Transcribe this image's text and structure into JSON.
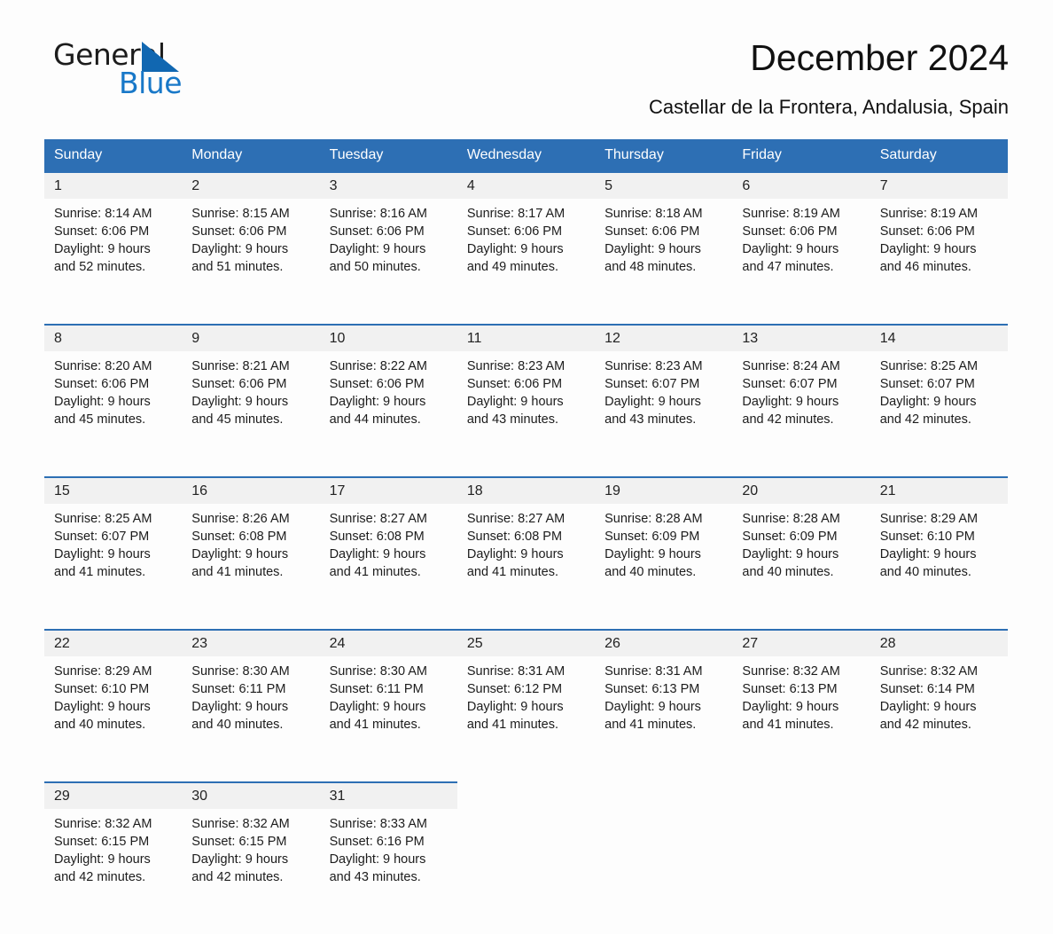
{
  "brand": {
    "name_part1": "General",
    "name_part2": "Blue",
    "accent_color": "#1167b1"
  },
  "header": {
    "title": "December 2024",
    "subtitle": "Castellar de la Frontera, Andalusia, Spain",
    "header_bg_color": "#2d6fb4",
    "date_band_color": "#f1f1f1"
  },
  "weekdays": [
    "Sunday",
    "Monday",
    "Tuesday",
    "Wednesday",
    "Thursday",
    "Friday",
    "Saturday"
  ],
  "weeks": [
    {
      "days": [
        {
          "date": "1",
          "sunrise": "Sunrise: 8:14 AM",
          "sunset": "Sunset: 6:06 PM",
          "daylight1": "Daylight: 9 hours",
          "daylight2": "and 52 minutes."
        },
        {
          "date": "2",
          "sunrise": "Sunrise: 8:15 AM",
          "sunset": "Sunset: 6:06 PM",
          "daylight1": "Daylight: 9 hours",
          "daylight2": "and 51 minutes."
        },
        {
          "date": "3",
          "sunrise": "Sunrise: 8:16 AM",
          "sunset": "Sunset: 6:06 PM",
          "daylight1": "Daylight: 9 hours",
          "daylight2": "and 50 minutes."
        },
        {
          "date": "4",
          "sunrise": "Sunrise: 8:17 AM",
          "sunset": "Sunset: 6:06 PM",
          "daylight1": "Daylight: 9 hours",
          "daylight2": "and 49 minutes."
        },
        {
          "date": "5",
          "sunrise": "Sunrise: 8:18 AM",
          "sunset": "Sunset: 6:06 PM",
          "daylight1": "Daylight: 9 hours",
          "daylight2": "and 48 minutes."
        },
        {
          "date": "6",
          "sunrise": "Sunrise: 8:19 AM",
          "sunset": "Sunset: 6:06 PM",
          "daylight1": "Daylight: 9 hours",
          "daylight2": "and 47 minutes."
        },
        {
          "date": "7",
          "sunrise": "Sunrise: 8:19 AM",
          "sunset": "Sunset: 6:06 PM",
          "daylight1": "Daylight: 9 hours",
          "daylight2": "and 46 minutes."
        }
      ]
    },
    {
      "days": [
        {
          "date": "8",
          "sunrise": "Sunrise: 8:20 AM",
          "sunset": "Sunset: 6:06 PM",
          "daylight1": "Daylight: 9 hours",
          "daylight2": "and 45 minutes."
        },
        {
          "date": "9",
          "sunrise": "Sunrise: 8:21 AM",
          "sunset": "Sunset: 6:06 PM",
          "daylight1": "Daylight: 9 hours",
          "daylight2": "and 45 minutes."
        },
        {
          "date": "10",
          "sunrise": "Sunrise: 8:22 AM",
          "sunset": "Sunset: 6:06 PM",
          "daylight1": "Daylight: 9 hours",
          "daylight2": "and 44 minutes."
        },
        {
          "date": "11",
          "sunrise": "Sunrise: 8:23 AM",
          "sunset": "Sunset: 6:06 PM",
          "daylight1": "Daylight: 9 hours",
          "daylight2": "and 43 minutes."
        },
        {
          "date": "12",
          "sunrise": "Sunrise: 8:23 AM",
          "sunset": "Sunset: 6:07 PM",
          "daylight1": "Daylight: 9 hours",
          "daylight2": "and 43 minutes."
        },
        {
          "date": "13",
          "sunrise": "Sunrise: 8:24 AM",
          "sunset": "Sunset: 6:07 PM",
          "daylight1": "Daylight: 9 hours",
          "daylight2": "and 42 minutes."
        },
        {
          "date": "14",
          "sunrise": "Sunrise: 8:25 AM",
          "sunset": "Sunset: 6:07 PM",
          "daylight1": "Daylight: 9 hours",
          "daylight2": "and 42 minutes."
        }
      ]
    },
    {
      "days": [
        {
          "date": "15",
          "sunrise": "Sunrise: 8:25 AM",
          "sunset": "Sunset: 6:07 PM",
          "daylight1": "Daylight: 9 hours",
          "daylight2": "and 41 minutes."
        },
        {
          "date": "16",
          "sunrise": "Sunrise: 8:26 AM",
          "sunset": "Sunset: 6:08 PM",
          "daylight1": "Daylight: 9 hours",
          "daylight2": "and 41 minutes."
        },
        {
          "date": "17",
          "sunrise": "Sunrise: 8:27 AM",
          "sunset": "Sunset: 6:08 PM",
          "daylight1": "Daylight: 9 hours",
          "daylight2": "and 41 minutes."
        },
        {
          "date": "18",
          "sunrise": "Sunrise: 8:27 AM",
          "sunset": "Sunset: 6:08 PM",
          "daylight1": "Daylight: 9 hours",
          "daylight2": "and 41 minutes."
        },
        {
          "date": "19",
          "sunrise": "Sunrise: 8:28 AM",
          "sunset": "Sunset: 6:09 PM",
          "daylight1": "Daylight: 9 hours",
          "daylight2": "and 40 minutes."
        },
        {
          "date": "20",
          "sunrise": "Sunrise: 8:28 AM",
          "sunset": "Sunset: 6:09 PM",
          "daylight1": "Daylight: 9 hours",
          "daylight2": "and 40 minutes."
        },
        {
          "date": "21",
          "sunrise": "Sunrise: 8:29 AM",
          "sunset": "Sunset: 6:10 PM",
          "daylight1": "Daylight: 9 hours",
          "daylight2": "and 40 minutes."
        }
      ]
    },
    {
      "days": [
        {
          "date": "22",
          "sunrise": "Sunrise: 8:29 AM",
          "sunset": "Sunset: 6:10 PM",
          "daylight1": "Daylight: 9 hours",
          "daylight2": "and 40 minutes."
        },
        {
          "date": "23",
          "sunrise": "Sunrise: 8:30 AM",
          "sunset": "Sunset: 6:11 PM",
          "daylight1": "Daylight: 9 hours",
          "daylight2": "and 40 minutes."
        },
        {
          "date": "24",
          "sunrise": "Sunrise: 8:30 AM",
          "sunset": "Sunset: 6:11 PM",
          "daylight1": "Daylight: 9 hours",
          "daylight2": "and 41 minutes."
        },
        {
          "date": "25",
          "sunrise": "Sunrise: 8:31 AM",
          "sunset": "Sunset: 6:12 PM",
          "daylight1": "Daylight: 9 hours",
          "daylight2": "and 41 minutes."
        },
        {
          "date": "26",
          "sunrise": "Sunrise: 8:31 AM",
          "sunset": "Sunset: 6:13 PM",
          "daylight1": "Daylight: 9 hours",
          "daylight2": "and 41 minutes."
        },
        {
          "date": "27",
          "sunrise": "Sunrise: 8:32 AM",
          "sunset": "Sunset: 6:13 PM",
          "daylight1": "Daylight: 9 hours",
          "daylight2": "and 41 minutes."
        },
        {
          "date": "28",
          "sunrise": "Sunrise: 8:32 AM",
          "sunset": "Sunset: 6:14 PM",
          "daylight1": "Daylight: 9 hours",
          "daylight2": "and 42 minutes."
        }
      ]
    },
    {
      "days": [
        {
          "date": "29",
          "sunrise": "Sunrise: 8:32 AM",
          "sunset": "Sunset: 6:15 PM",
          "daylight1": "Daylight: 9 hours",
          "daylight2": "and 42 minutes."
        },
        {
          "date": "30",
          "sunrise": "Sunrise: 8:32 AM",
          "sunset": "Sunset: 6:15 PM",
          "daylight1": "Daylight: 9 hours",
          "daylight2": "and 42 minutes."
        },
        {
          "date": "31",
          "sunrise": "Sunrise: 8:33 AM",
          "sunset": "Sunset: 6:16 PM",
          "daylight1": "Daylight: 9 hours",
          "daylight2": "and 43 minutes."
        },
        {
          "date": "",
          "sunrise": "",
          "sunset": "",
          "daylight1": "",
          "daylight2": ""
        },
        {
          "date": "",
          "sunrise": "",
          "sunset": "",
          "daylight1": "",
          "daylight2": ""
        },
        {
          "date": "",
          "sunrise": "",
          "sunset": "",
          "daylight1": "",
          "daylight2": ""
        },
        {
          "date": "",
          "sunrise": "",
          "sunset": "",
          "daylight1": "",
          "daylight2": ""
        }
      ]
    }
  ]
}
